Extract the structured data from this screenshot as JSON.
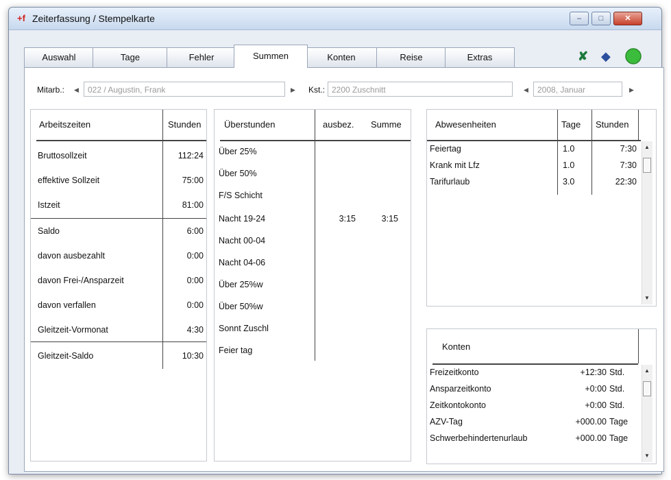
{
  "window": {
    "title": "Zeiterfassung / Stempelkarte",
    "app_icon": "+f",
    "buttons": {
      "minimize": "–",
      "maximize": "□",
      "close": "✕"
    }
  },
  "tabs": [
    {
      "label": "Auswahl"
    },
    {
      "label": "Tage"
    },
    {
      "label": "Fehler"
    },
    {
      "label": "Summen"
    },
    {
      "label": "Konten"
    },
    {
      "label": "Reise"
    },
    {
      "label": "Extras"
    }
  ],
  "toolbar": {
    "excel_icon": "excel-icon",
    "book_icon": "book-icon",
    "status_icon": "green-status-icon",
    "accent": "#3cbc3c"
  },
  "filters": {
    "mitarb_label": "Mitarb.:",
    "mitarb_value": "022 / Augustin, Frank",
    "kst_label": "Kst.:",
    "kst_value": "2200 Zuschnitt",
    "period_value": "2008, Januar"
  },
  "arbeitszeiten": {
    "col1": "Arbeitszeiten",
    "col2": "Stunden",
    "rows": [
      {
        "label": "Bruttosollzeit",
        "value": "112:24"
      },
      {
        "label": "effektive Sollzeit",
        "value": "75:00"
      },
      {
        "label": "Istzeit",
        "value": "81:00"
      },
      {
        "label": "Saldo",
        "value": "6:00"
      },
      {
        "label": "davon ausbezahlt",
        "value": "0:00"
      },
      {
        "label": "davon Frei-/Ansparzeit",
        "value": "0:00"
      },
      {
        "label": "davon verfallen",
        "value": "0:00"
      },
      {
        "label": "Gleitzeit-Vormonat",
        "value": "4:30"
      },
      {
        "label": "Gleitzeit-Saldo",
        "value": "10:30"
      }
    ]
  },
  "ueberstunden": {
    "col1": "Überstunden",
    "col2": "ausbez.",
    "col3": "Summe",
    "rows": [
      {
        "label": "Über 25%",
        "ausbez": "",
        "summe": ""
      },
      {
        "label": "Über 50%",
        "ausbez": "",
        "summe": ""
      },
      {
        "label": "F/S Schicht",
        "ausbez": "",
        "summe": ""
      },
      {
        "label": "Nacht 19-24",
        "ausbez": "3:15",
        "summe": "3:15"
      },
      {
        "label": "Nacht 00-04",
        "ausbez": "",
        "summe": ""
      },
      {
        "label": "Nacht 04-06",
        "ausbez": "",
        "summe": ""
      },
      {
        "label": "Über 25%w",
        "ausbez": "",
        "summe": ""
      },
      {
        "label": "Über 50%w",
        "ausbez": "",
        "summe": ""
      },
      {
        "label": "Sonnt Zuschl",
        "ausbez": "",
        "summe": ""
      },
      {
        "label": "Feier tag",
        "ausbez": "",
        "summe": ""
      }
    ]
  },
  "abwesenheiten": {
    "col1": "Abwesenheiten",
    "col2": "Tage",
    "col3": "Stunden",
    "rows": [
      {
        "label": "Feiertag",
        "tage": "1.0",
        "stunden": "7:30"
      },
      {
        "label": "Krank mit Lfz",
        "tage": "1.0",
        "stunden": "7:30"
      },
      {
        "label": "Tarifurlaub",
        "tage": "3.0",
        "stunden": "22:30"
      }
    ]
  },
  "konten": {
    "col1": "Konten",
    "rows": [
      {
        "label": "Freizeitkonto",
        "value": "+12:30",
        "unit": "Std."
      },
      {
        "label": "Ansparzeitkonto",
        "value": "+0:00",
        "unit": "Std."
      },
      {
        "label": "Zeitkontokonto",
        "value": "+0:00",
        "unit": "Std."
      },
      {
        "label": "AZV-Tag",
        "value": "+000.00",
        "unit": "Tage"
      },
      {
        "label": "Schwerbehindertenurlaub",
        "value": "+000.00",
        "unit": "Tage"
      }
    ]
  }
}
